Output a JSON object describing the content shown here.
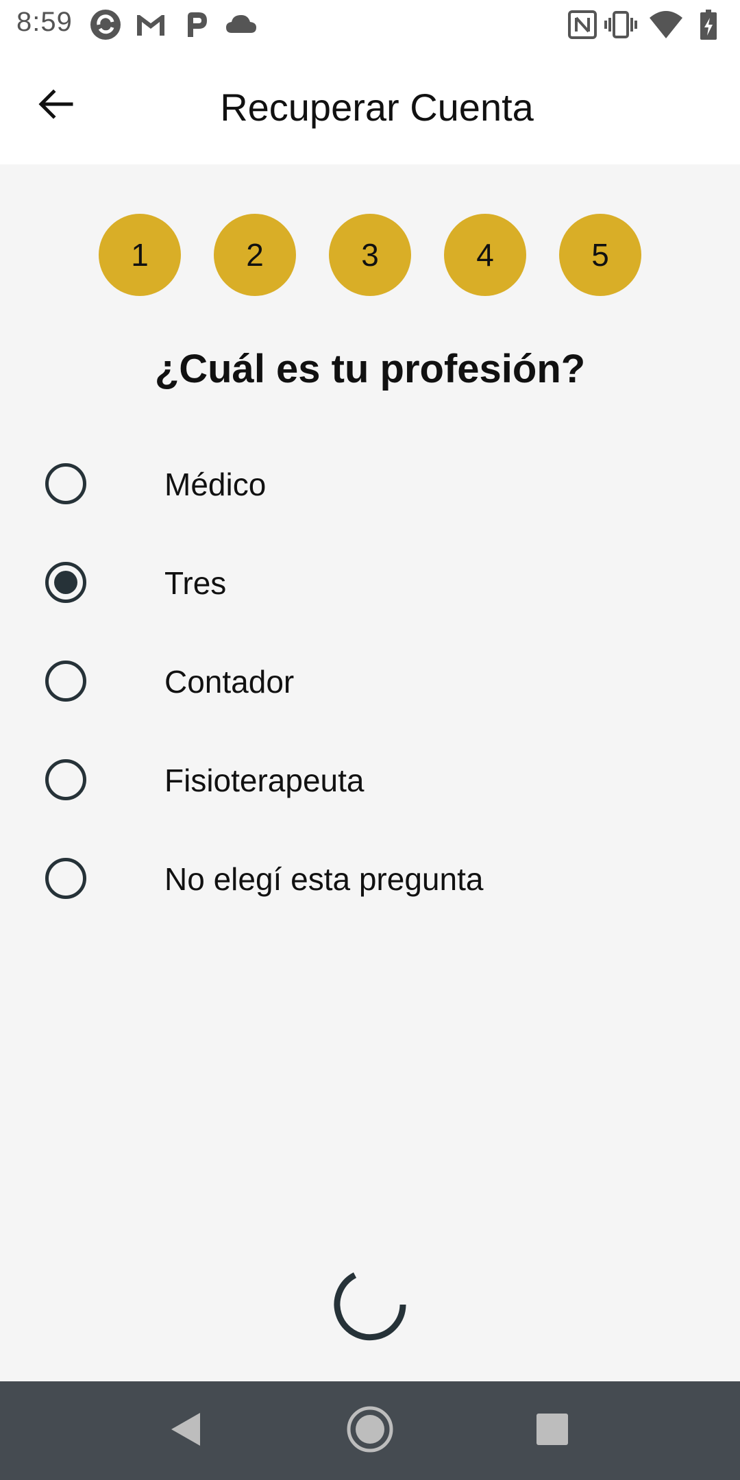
{
  "status_bar": {
    "time": "8:59",
    "left_icons": [
      "camera-sync-icon",
      "gmail-icon",
      "p-app-icon",
      "cloud-icon"
    ],
    "right_icons": [
      "nfc-icon",
      "vibrate-icon",
      "wifi-icon",
      "battery-charging-icon"
    ]
  },
  "app_bar": {
    "back_icon": "arrow-back-icon",
    "title": "Recuperar Cuenta"
  },
  "steps": [
    "1",
    "2",
    "3",
    "4",
    "5"
  ],
  "step_color": "#d9ae27",
  "question": "¿Cuál es tu profesión?",
  "options": [
    {
      "label": "Médico",
      "selected": false
    },
    {
      "label": "Tres",
      "selected": true
    },
    {
      "label": "Contador",
      "selected": false
    },
    {
      "label": "Fisioterapeuta",
      "selected": false
    },
    {
      "label": "No elegí esta pregunta",
      "selected": false
    }
  ],
  "loading": true,
  "nav_bar": {
    "icons": [
      "back-triangle-icon",
      "home-circle-icon",
      "recents-square-icon"
    ],
    "color": "#454b51"
  }
}
